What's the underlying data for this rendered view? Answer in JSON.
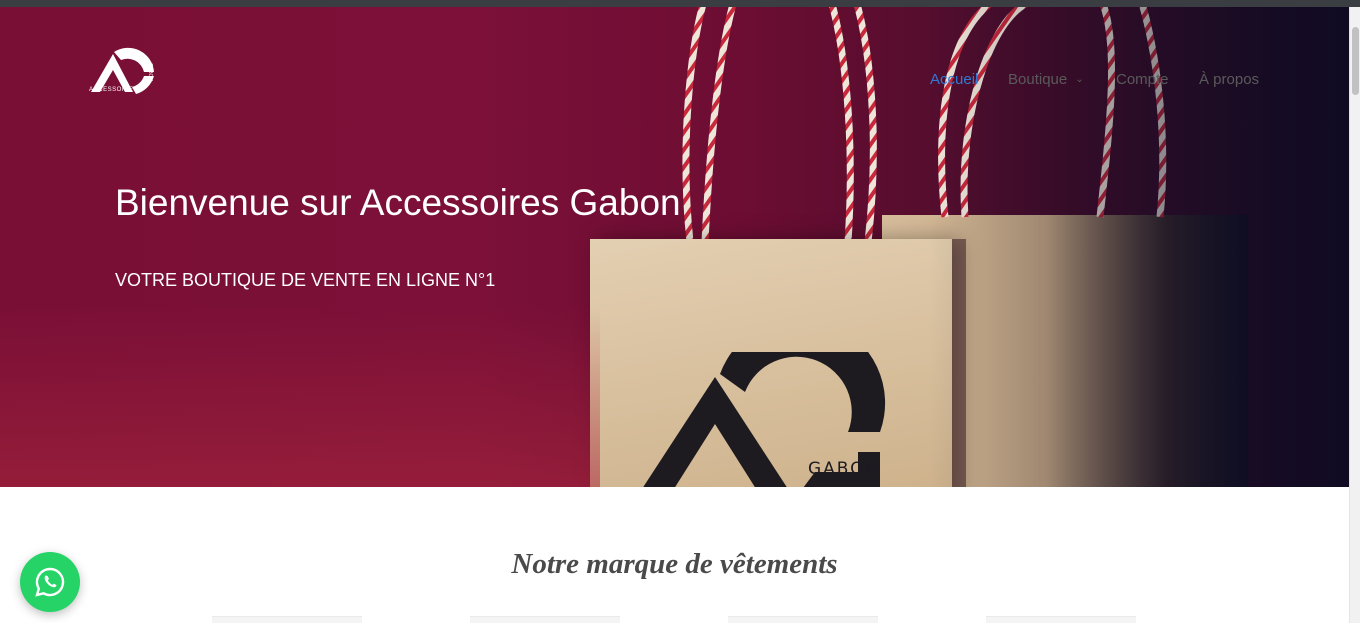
{
  "brand": {
    "logo_text": "ACCESSOIRES",
    "logo_subtext": "GABON"
  },
  "nav": {
    "items": [
      {
        "label": "Accueil",
        "active": true,
        "has_dropdown": false
      },
      {
        "label": "Boutique",
        "active": false,
        "has_dropdown": true
      },
      {
        "label": "Compte",
        "active": false,
        "has_dropdown": false
      },
      {
        "label": "À propos",
        "active": false,
        "has_dropdown": false
      }
    ]
  },
  "hero": {
    "title": "Bienvenue sur Accessoires Gabon",
    "subtitle": "VOTRE BOUTIQUE DE VENTE EN LIGNE N°1",
    "bag_brand_text": "GABON"
  },
  "section": {
    "title": "Notre marque de vêtements"
  },
  "colors": {
    "hero_background": "#7a0f36",
    "nav_active": "#2f7ad6",
    "whatsapp": "#25d366"
  },
  "icons": {
    "chat": "whatsapp-icon",
    "dropdown": "chevron-down-icon"
  }
}
